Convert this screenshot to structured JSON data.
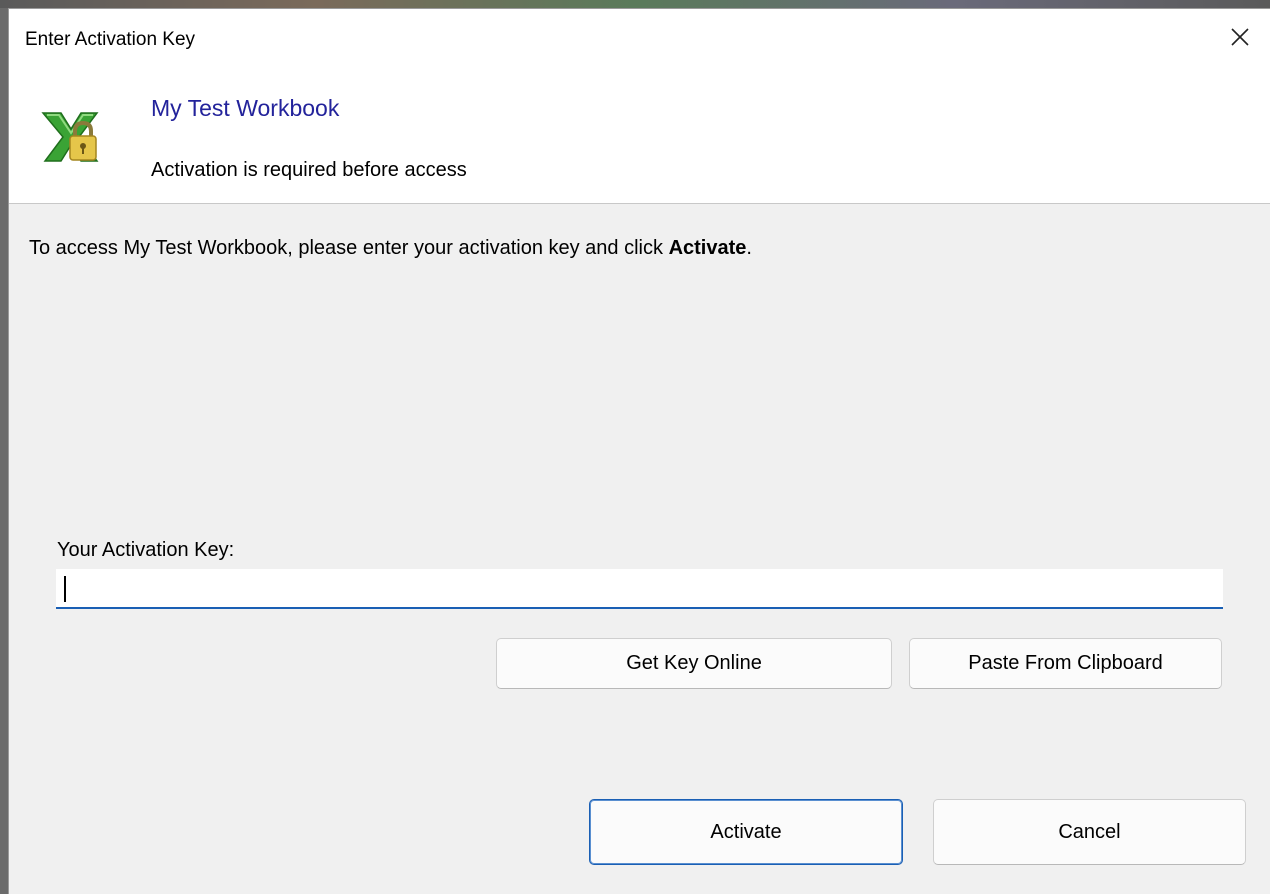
{
  "window": {
    "title": "Enter Activation Key"
  },
  "header": {
    "title": "My Test Workbook",
    "subtitle": "Activation is required before access"
  },
  "instructions": {
    "prefix": "To access My Test Workbook, please enter your activation key and click ",
    "emphasis": "Activate",
    "suffix": "."
  },
  "key_field": {
    "label": "Your Activation Key:",
    "value": "",
    "placeholder": ""
  },
  "buttons": {
    "get_key_online": "Get Key Online",
    "paste_from_clipboard": "Paste From Clipboard",
    "activate": "Activate",
    "cancel": "Cancel"
  },
  "icons": {
    "app": "excel-lock-icon",
    "close": "close-icon"
  },
  "colors": {
    "header_title": "#23239b",
    "input_underline": "#1a5fb4",
    "dialog_bg": "#f0f0f0"
  }
}
